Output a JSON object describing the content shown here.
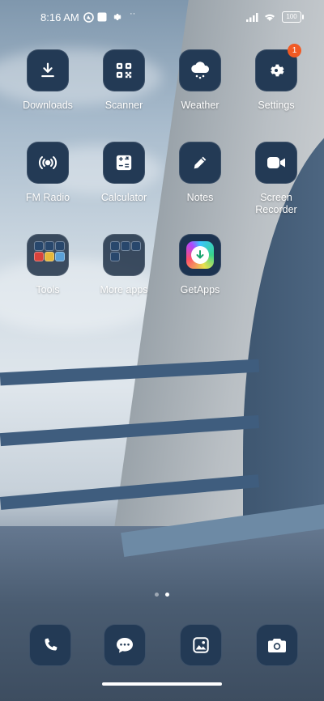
{
  "status_bar": {
    "time": "8:16 AM",
    "battery": "100"
  },
  "apps": [
    {
      "label": "Downloads"
    },
    {
      "label": "Scanner"
    },
    {
      "label": "Weather"
    },
    {
      "label": "Settings",
      "badge": "1"
    },
    {
      "label": "FM Radio"
    },
    {
      "label": "Calculator"
    },
    {
      "label": "Notes"
    },
    {
      "label": "Screen Recorder"
    },
    {
      "label": "Tools"
    },
    {
      "label": "More apps"
    },
    {
      "label": "GetApps"
    }
  ],
  "page_indicator": {
    "pages": 2,
    "current": 2
  },
  "dock": [
    {
      "icon": "phone-icon"
    },
    {
      "icon": "messages-icon"
    },
    {
      "icon": "gallery-icon"
    },
    {
      "icon": "camera-icon"
    }
  ],
  "colors": {
    "icon_bg": "#233a55",
    "badge": "#f15a24"
  }
}
